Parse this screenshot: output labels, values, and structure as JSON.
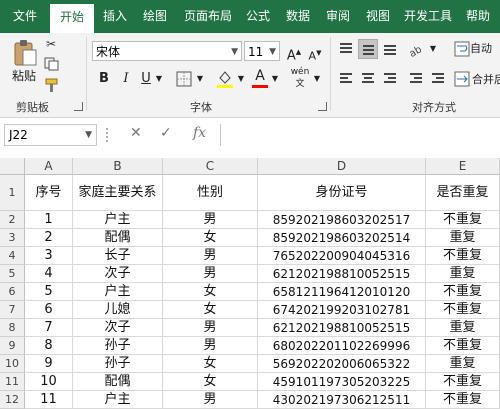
{
  "ribbon_tabs": [
    {
      "label": "文件"
    },
    {
      "label": "开始"
    },
    {
      "label": "插入"
    },
    {
      "label": "绘图"
    },
    {
      "label": "页面布局"
    },
    {
      "label": "公式"
    },
    {
      "label": "数据"
    },
    {
      "label": "审阅"
    },
    {
      "label": "视图"
    },
    {
      "label": "开发工具"
    },
    {
      "label": "帮助"
    }
  ],
  "active_tab": "开始",
  "accent_color": "#217346",
  "clipboard": {
    "paste_label": "粘贴",
    "group_label": "剪贴板"
  },
  "font": {
    "name": "宋体",
    "size": "11",
    "bold": "B",
    "italic": "I",
    "underline": "U",
    "group_label": "字体",
    "font_color": "#ff0000"
  },
  "alignment": {
    "merge_label": "合并后",
    "wrap_label": "自动",
    "group_label": "对齐方式"
  },
  "formula_bar": {
    "name_box": "J22",
    "cancel": "✕",
    "enter": "✓",
    "fx": "fx",
    "formula": ""
  },
  "grid": {
    "columns": [
      "A",
      "B",
      "C",
      "D",
      "E"
    ],
    "row_numbers": [
      "1",
      "2",
      "3",
      "4",
      "5",
      "6",
      "7",
      "8",
      "9",
      "10",
      "11",
      "12"
    ],
    "header": [
      "序号",
      "家庭主要关系",
      "性别",
      "身份证号",
      "是否重复"
    ],
    "rows": [
      [
        "1",
        "户主",
        "男",
        "859202198603202517",
        "不重复"
      ],
      [
        "2",
        "配偶",
        "女",
        "859202198603202514",
        "重复"
      ],
      [
        "3",
        "长子",
        "男",
        "765202200904045316",
        "不重复"
      ],
      [
        "4",
        "次子",
        "男",
        "621202198810052515",
        "重复"
      ],
      [
        "5",
        "户主",
        "女",
        "658121196412010120",
        "不重复"
      ],
      [
        "6",
        "儿媳",
        "女",
        "674202199203102781",
        "不重复"
      ],
      [
        "7",
        "次子",
        "男",
        "621202198810052515",
        "重复"
      ],
      [
        "8",
        "孙子",
        "男",
        "680202201102269996",
        "不重复"
      ],
      [
        "9",
        "孙子",
        "女",
        "569202202006065322",
        "重复"
      ],
      [
        "10",
        "配偶",
        "女",
        "459101197305203225",
        "不重复"
      ],
      [
        "11",
        "户主",
        "男",
        "430202197306212511",
        "不重复"
      ]
    ]
  }
}
